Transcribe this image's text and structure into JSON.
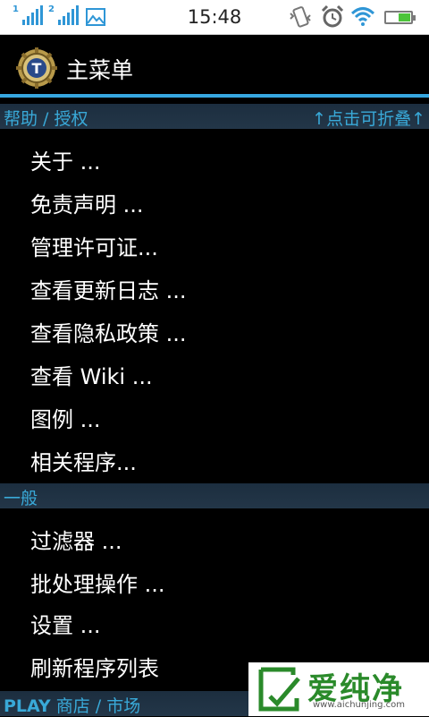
{
  "status_bar": {
    "time": "15:48",
    "sim1_label": "1",
    "sim2_label": "2",
    "battery_level": 0.5
  },
  "action_bar": {
    "title": "主菜单",
    "icon": "titanium-backup-icon"
  },
  "sections": {
    "help": {
      "title": "帮助 / 授权",
      "collapse_hint": "↑点击可折叠↑",
      "items": [
        "关于 ...",
        "免责声明 ...",
        "管理许可证...",
        "查看更新日志 ...",
        "查看隐私政策 ...",
        "查看 Wiki ...",
        "图例 ...",
        "相关程序..."
      ]
    },
    "general": {
      "title": "一般",
      "items": [
        "过滤器 ...",
        "批处理操作 ...",
        "设置 ...",
        "刷新程序列表"
      ]
    },
    "store": {
      "title_bold": "PLAY",
      "title_rest": " 商店 / 市场"
    }
  },
  "watermark": {
    "title": "爱纯净",
    "url": "www.aichunjing.com"
  },
  "colors": {
    "accent": "#37a7e0",
    "section_text": "#39a9d8",
    "section_bg": "#1f3244",
    "background": "#000000"
  }
}
